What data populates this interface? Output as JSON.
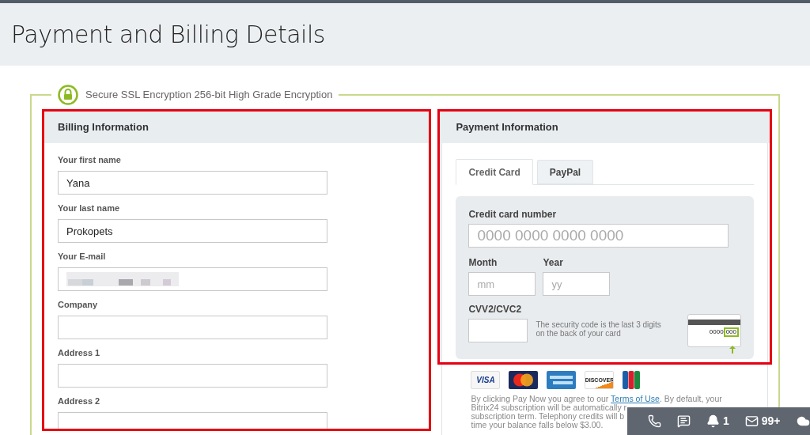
{
  "page_title": "Payment and Billing Details",
  "secure_notice": "Secure SSL Encryption 256-bit High Grade Encryption",
  "billing": {
    "title": "Billing Information",
    "fields": [
      {
        "kind": "text",
        "label": "Your first name",
        "value": "Yana"
      },
      {
        "kind": "text",
        "label": "Your last name",
        "value": "Prokopets"
      },
      {
        "kind": "redacted",
        "label": "Your E-mail"
      },
      {
        "kind": "text",
        "label": "Company"
      },
      {
        "kind": "text",
        "label": "Address 1"
      },
      {
        "kind": "text",
        "label": "Address 2"
      }
    ]
  },
  "payment": {
    "title": "Payment Information",
    "tabs": [
      {
        "label": "Credit Card",
        "selected": true
      },
      {
        "label": "PayPal",
        "selected": false
      }
    ],
    "card_number": {
      "label": "Credit card number",
      "placeholder": "0000 0000 0000 0000"
    },
    "month": {
      "label": "Month",
      "placeholder": "mm"
    },
    "year": {
      "label": "Year",
      "placeholder": "yy"
    },
    "cvv": {
      "label": "CVV2/CVC2",
      "hint": "The security code is the last 3 digits on the back of your card",
      "card_number": "0000",
      "card_code": "000"
    },
    "card_logos": [
      {
        "kind": "visa",
        "label": "VISA"
      },
      {
        "kind": "mastercard"
      },
      {
        "kind": "amex"
      },
      {
        "kind": "discover",
        "label": "DISCOVER"
      },
      {
        "kind": "jcb"
      }
    ],
    "terms": {
      "before": "By clicking Pay Now you agree to our ",
      "link": "Terms of Use",
      "after": ". By default, your",
      "lines": [
        "Bitrix24 subscription will be automatically r",
        "subscription term. Telephony credits will b",
        "time your balance falls below $3.00."
      ]
    }
  },
  "toolbar": [
    {
      "kind": "phone"
    },
    {
      "kind": "chat"
    },
    {
      "kind": "bell",
      "count": "1"
    },
    {
      "kind": "mail",
      "count": "99+"
    },
    {
      "kind": "cloud"
    }
  ]
}
